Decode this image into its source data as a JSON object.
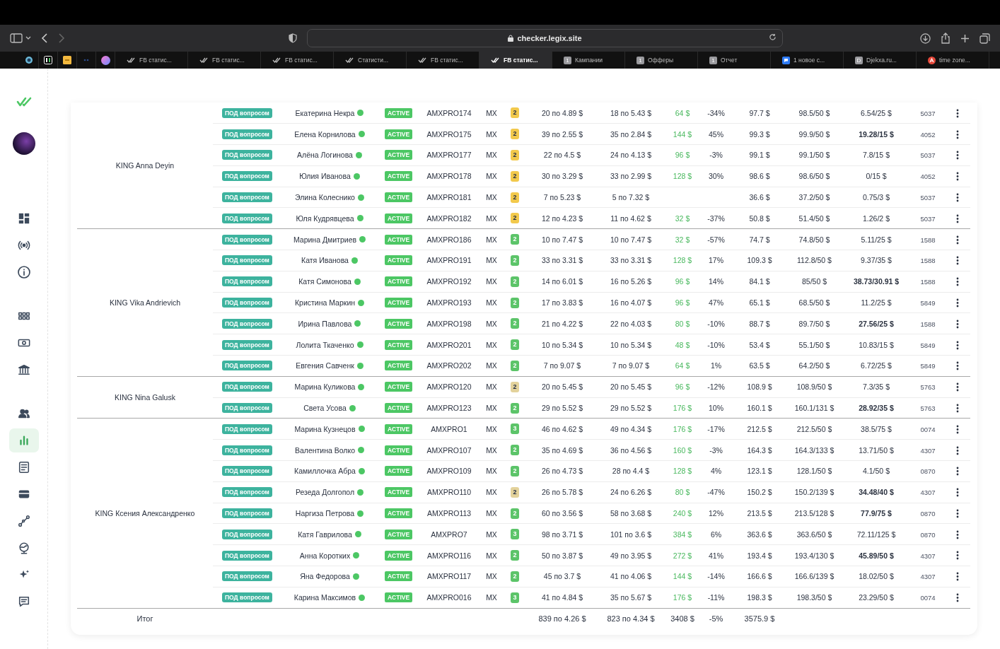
{
  "browser": {
    "url": "checker.legix.site",
    "pinned": [
      {
        "kind": "round"
      },
      {
        "kind": "lr"
      },
      {
        "kind": "ad"
      },
      {
        "kind": "dark"
      },
      {
        "kind": "gradient"
      }
    ],
    "tabs": [
      {
        "kind": "check",
        "title": "FB статис...",
        "selected": false
      },
      {
        "kind": "check",
        "title": "FB статис...",
        "selected": false
      },
      {
        "kind": "check",
        "title": "FB статис...",
        "selected": false
      },
      {
        "kind": "check",
        "title": "Статисти...",
        "selected": false
      },
      {
        "kind": "check",
        "title": "FB статис...",
        "selected": false
      },
      {
        "kind": "check",
        "title": "FB статис...",
        "selected": true
      },
      {
        "kind": "badge",
        "badge": "1",
        "title": "Кампании",
        "selected": false
      },
      {
        "kind": "badge",
        "badge": "1",
        "title": "Офферы",
        "selected": false
      },
      {
        "kind": "badge",
        "badge": "1",
        "title": "Отчет",
        "selected": false
      },
      {
        "kind": "chat",
        "title": "1 новое с...",
        "selected": false
      },
      {
        "kind": "badge",
        "badge": "D",
        "title": "Djekxa.ru...",
        "selected": false
      },
      {
        "kind": "red",
        "title": "time zone...",
        "selected": false
      }
    ]
  },
  "sidebar": {
    "groups": [
      [
        {
          "selected": false
        },
        {
          "selected": false
        },
        {
          "selected": false
        }
      ],
      [
        {
          "selected": false
        },
        {
          "selected": false
        },
        {
          "selected": false
        }
      ],
      [
        {
          "selected": false
        },
        {
          "selected": true
        },
        {
          "selected": false
        },
        {
          "selected": false
        },
        {
          "selected": false
        },
        {
          "selected": false
        },
        {
          "selected": false
        },
        {
          "selected": false
        }
      ]
    ]
  },
  "table": {
    "groups": [
      {
        "label": "KING Anna Deyin",
        "rows": [
          {
            "tag": "ПОД вопросом",
            "name": "Екатерина Некра",
            "status": "ACTIVE",
            "code": "AMXPRO174",
            "geo": "MX",
            "tier": "2",
            "color": "#f2c94c",
            "column_7": "20 по 4.89 $",
            "column_8": "18 по 5.43 $",
            "column_9": "64 $",
            "column_10": "-34%",
            "column_11": "97.7 $",
            "column_12": "98.5/50 $",
            "column_13": "6.54/25 $",
            "bold": false,
            "column_14": "5037"
          },
          {
            "tag": "ПОД вопросом",
            "name": "Елена Корнилова",
            "status": "ACTIVE",
            "code": "AMXPRO175",
            "geo": "MX",
            "tier": "2",
            "color": "#f2c94c",
            "column_7": "39 по 2.55 $",
            "column_8": "35 по 2.84 $",
            "column_9": "144 $",
            "column_10": "45%",
            "column_11": "99.3 $",
            "column_12": "99.9/50 $",
            "column_13": "19.28/15 $",
            "bold": true,
            "column_14": "4052"
          },
          {
            "tag": "ПОД вопросом",
            "name": "Алёна Логинова",
            "status": "ACTIVE",
            "code": "AMXPRO177",
            "geo": "MX",
            "tier": "2",
            "color": "#f2c94c",
            "column_7": "22 по 4.5 $",
            "column_8": "24 по 4.13 $",
            "column_9": "96 $",
            "column_10": "-3%",
            "column_11": "99.1 $",
            "column_12": "99.1/50 $",
            "column_13": "7.8/15 $",
            "bold": false,
            "column_14": "5037"
          },
          {
            "tag": "ПОД вопросом",
            "name": "Юлия Иванова",
            "status": "ACTIVE",
            "code": "AMXPRO178",
            "geo": "MX",
            "tier": "2",
            "color": "#f2c94c",
            "column_7": "30 по 3.29 $",
            "column_8": "33 по 2.99 $",
            "column_9": "128 $",
            "column_10": "30%",
            "column_11": "98.6 $",
            "column_12": "98.6/50 $",
            "column_13": "0/15 $",
            "bold": false,
            "column_14": "4052"
          },
          {
            "tag": "ПОД вопросом",
            "name": "Элина Колеснико",
            "status": "ACTIVE",
            "code": "AMXPRO181",
            "geo": "MX",
            "tier": "2",
            "color": "#f2c94c",
            "column_7": "7 по 5.23 $",
            "column_8": "5 по 7.32 $",
            "column_11": "36.6 $",
            "column_12": "37.2/50 $",
            "column_13": "0.75/3 $",
            "bold": false,
            "column_14": "5037"
          },
          {
            "tag": "ПОД вопросом",
            "name": "Юля Кудрявцева",
            "status": "ACTIVE",
            "code": "AMXPRO182",
            "geo": "MX",
            "tier": "2",
            "color": "#f2c94c",
            "column_7": "12 по 4.23 $",
            "column_8": "11 по 4.62 $",
            "column_9": "32 $",
            "column_10": "-37%",
            "column_11": "50.8 $",
            "column_12": "51.4/50 $",
            "column_13": "1.26/2 $",
            "bold": false,
            "column_14": "5037"
          }
        ]
      },
      {
        "label": "KING Vika Andrievich",
        "rows": [
          {
            "tag": "ПОД вопросом",
            "name": "Марина Дмитриев",
            "status": "ACTIVE",
            "code": "AMXPRO186",
            "geo": "MX",
            "tier": "2",
            "color": "#5cc469",
            "column_7": "10 по 7.47 $",
            "column_8": "10 по 7.47 $",
            "column_9": "32 $",
            "column_10": "-57%",
            "column_11": "74.7 $",
            "column_12": "74.8/50 $",
            "column_13": "5.11/25 $",
            "bold": false,
            "column_14": "1588"
          },
          {
            "tag": "ПОД вопросом",
            "name": "Катя Иванова",
            "status": "ACTIVE",
            "code": "AMXPRO191",
            "geo": "MX",
            "tier": "2",
            "color": "#5cc469",
            "column_7": "33 по 3.31 $",
            "column_8": "33 по 3.31 $",
            "column_9": "128 $",
            "column_10": "17%",
            "column_11": "109.3 $",
            "column_12": "112.8/50 $",
            "column_13": "9.37/35 $",
            "bold": false,
            "column_14": "1588"
          },
          {
            "tag": "ПОД вопросом",
            "name": "Катя Симонова",
            "status": "ACTIVE",
            "code": "AMXPRO192",
            "geo": "MX",
            "tier": "2",
            "color": "#5cc469",
            "column_7": "14 по 6.01 $",
            "column_8": "16 по 5.26 $",
            "column_9": "96 $",
            "column_10": "14%",
            "column_11": "84.1 $",
            "column_12": "85/50 $",
            "column_13": "38.73/30.91 $",
            "bold": true,
            "column_14": "1588"
          },
          {
            "tag": "ПОД вопросом",
            "name": "Кристина Маркин",
            "status": "ACTIVE",
            "code": "AMXPRO193",
            "geo": "MX",
            "tier": "2",
            "color": "#5cc469",
            "column_7": "17 по 3.83 $",
            "column_8": "16 по 4.07 $",
            "column_9": "96 $",
            "column_10": "47%",
            "column_11": "65.1 $",
            "column_12": "68.5/50 $",
            "column_13": "11.2/25 $",
            "bold": false,
            "column_14": "5849"
          },
          {
            "tag": "ПОД вопросом",
            "name": "Ирина Павлова",
            "status": "ACTIVE",
            "code": "AMXPRO198",
            "geo": "MX",
            "tier": "2",
            "color": "#5cc469",
            "column_7": "21 по 4.22 $",
            "column_8": "22 по 4.03 $",
            "column_9": "80 $",
            "column_10": "-10%",
            "column_11": "88.7 $",
            "column_12": "89.7/50 $",
            "column_13": "27.56/25 $",
            "bold": true,
            "column_14": "1588"
          },
          {
            "tag": "ПОД вопросом",
            "name": "Лолита Ткаченко",
            "status": "ACTIVE",
            "code": "AMXPRO201",
            "geo": "MX",
            "tier": "2",
            "color": "#5cc469",
            "column_7": "10 по 5.34 $",
            "column_8": "10 по 5.34 $",
            "column_9": "48 $",
            "column_10": "-10%",
            "column_11": "53.4 $",
            "column_12": "55.1/50 $",
            "column_13": "10.83/15 $",
            "bold": false,
            "column_14": "5849"
          },
          {
            "tag": "ПОД вопросом",
            "name": "Евгения Савченк",
            "status": "ACTIVE",
            "code": "AMXPRO202",
            "geo": "MX",
            "tier": "2",
            "color": "#5cc469",
            "column_7": "7 по 9.07 $",
            "column_8": "7 по 9.07 $",
            "column_9": "64 $",
            "column_10": "1%",
            "column_11": "63.5 $",
            "column_12": "64.2/50 $",
            "column_13": "6.72/25 $",
            "bold": false,
            "column_14": "5849"
          }
        ]
      },
      {
        "label": "KING Nina Galusk",
        "rows": [
          {
            "tag": "ПОД вопросом",
            "name": "Марина Куликова",
            "status": "ACTIVE",
            "code": "AMXPRO120",
            "geo": "MX",
            "tier": "2",
            "color": "#e3d29b",
            "column_7": "20 по 5.45 $",
            "column_8": "20 по 5.45 $",
            "column_9": "96 $",
            "column_10": "-12%",
            "column_11": "108.9 $",
            "column_12": "108.9/50 $",
            "column_13": "7.3/35 $",
            "bold": false,
            "column_14": "5763"
          },
          {
            "tag": "ПОД вопросом",
            "name": "Света Усова",
            "status": "ACTIVE",
            "code": "AMXPRO123",
            "geo": "MX",
            "tier": "2",
            "color": "#5cc469",
            "column_7": "29 по 5.52 $",
            "column_8": "29 по 5.52 $",
            "column_9": "176 $",
            "column_10": "10%",
            "column_11": "160.1 $",
            "column_12": "160.1/131 $",
            "column_13": "28.92/35 $",
            "bold": true,
            "column_14": "5763"
          }
        ]
      },
      {
        "label": "KING Ксения Александренко",
        "rows": [
          {
            "tag": "ПОД вопросом",
            "name": "Марина Кузнецов",
            "status": "ACTIVE",
            "code": "AMXPRO1",
            "geo": "MX",
            "tier": "3",
            "color": "#5cc469",
            "column_7": "46 по 4.62 $",
            "column_8": "49 по 4.34 $",
            "column_9": "176 $",
            "column_10": "-17%",
            "column_11": "212.5 $",
            "column_12": "212.5/50 $",
            "column_13": "38.5/75 $",
            "bold": false,
            "column_14": "0074"
          },
          {
            "tag": "ПОД вопросом",
            "name": "Валентина Волко",
            "status": "ACTIVE",
            "code": "AMXPRO107",
            "geo": "MX",
            "tier": "2",
            "color": "#5cc469",
            "column_7": "35 по 4.69 $",
            "column_8": "36 по 4.56 $",
            "column_9": "160 $",
            "column_10": "-3%",
            "column_11": "164.3 $",
            "column_12": "164.3/133 $",
            "column_13": "13.71/50 $",
            "bold": false,
            "column_14": "4307"
          },
          {
            "tag": "ПОД вопросом",
            "name": "Камиллочка Абра",
            "status": "ACTIVE",
            "code": "AMXPRO109",
            "geo": "MX",
            "tier": "2",
            "color": "#5cc469",
            "column_7": "26 по 4.73 $",
            "column_8": "28 по 4.4 $",
            "column_9": "128 $",
            "column_10": "4%",
            "column_11": "123.1 $",
            "column_12": "128.1/50 $",
            "column_13": "4.1/50 $",
            "bold": false,
            "column_14": "0870"
          },
          {
            "tag": "ПОД вопросом",
            "name": "Резеда Долгопол",
            "status": "ACTIVE",
            "code": "AMXPRO110",
            "geo": "MX",
            "tier": "2",
            "color": "#e3d29b",
            "column_7": "26 по 5.78 $",
            "column_8": "24 по 6.26 $",
            "column_9": "80 $",
            "column_10": "-47%",
            "column_11": "150.2 $",
            "column_12": "150.2/139 $",
            "column_13": "34.48/40 $",
            "bold": true,
            "column_14": "4307"
          },
          {
            "tag": "ПОД вопросом",
            "name": "Наргиза Петрова",
            "status": "ACTIVE",
            "code": "AMXPRO113",
            "geo": "MX",
            "tier": "2",
            "color": "#5cc469",
            "column_7": "60 по 3.56 $",
            "column_8": "58 по 3.68 $",
            "column_9": "240 $",
            "column_10": "12%",
            "column_11": "213.5 $",
            "column_12": "213.5/128 $",
            "column_13": "77.9/75 $",
            "bold": true,
            "column_14": "0870"
          },
          {
            "tag": "ПОД вопросом",
            "name": "Катя Гаврилова",
            "status": "ACTIVE",
            "code": "AMXPRO7",
            "geo": "MX",
            "tier": "3",
            "color": "#5cc469",
            "column_7": "98 по 3.71 $",
            "column_8": "101 по 3.6 $",
            "column_9": "384 $",
            "column_10": "6%",
            "column_11": "363.6 $",
            "column_12": "363.6/50 $",
            "column_13": "72.11/125 $",
            "bold": false,
            "column_14": "0870"
          },
          {
            "tag": "ПОД вопросом",
            "name": "Анна Коротких",
            "status": "ACTIVE",
            "code": "AMXPRO116",
            "geo": "MX",
            "tier": "2",
            "color": "#5cc469",
            "column_7": "50 по 3.87 $",
            "column_8": "49 по 3.95 $",
            "column_9": "272 $",
            "column_10": "41%",
            "column_11": "193.4 $",
            "column_12": "193.4/130 $",
            "column_13": "45.89/50 $",
            "bold": true,
            "column_14": "4307"
          },
          {
            "tag": "ПОД вопросом",
            "name": "Яна Федорова",
            "status": "ACTIVE",
            "code": "AMXPRO117",
            "geo": "MX",
            "tier": "2",
            "color": "#5cc469",
            "column_7": "45 по 3.7 $",
            "column_8": "41 по 4.06 $",
            "column_9": "144 $",
            "column_10": "-14%",
            "column_11": "166.6 $",
            "column_12": "166.6/139 $",
            "column_13": "18.02/50 $",
            "bold": false,
            "column_14": "4307"
          },
          {
            "tag": "ПОД вопросом",
            "name": "Карина Максимов",
            "status": "ACTIVE",
            "code": "AMXPRO016",
            "geo": "MX",
            "tier": "3",
            "color": "#5cc469",
            "column_7": "41 по 4.84 $",
            "column_8": "35 по 5.67 $",
            "column_9": "176 $",
            "column_10": "-11%",
            "column_11": "198.3 $",
            "column_12": "198.3/50 $",
            "column_13": "23.29/50 $",
            "bold": false,
            "column_14": "0074"
          }
        ]
      }
    ],
    "total": {
      "label": "Итог",
      "column_7": "839 по 4.26 $",
      "column_8": "823 по 4.34 $",
      "column_9": "3408 $",
      "column_10": "-5%",
      "column_11": "3575.9 $"
    }
  }
}
